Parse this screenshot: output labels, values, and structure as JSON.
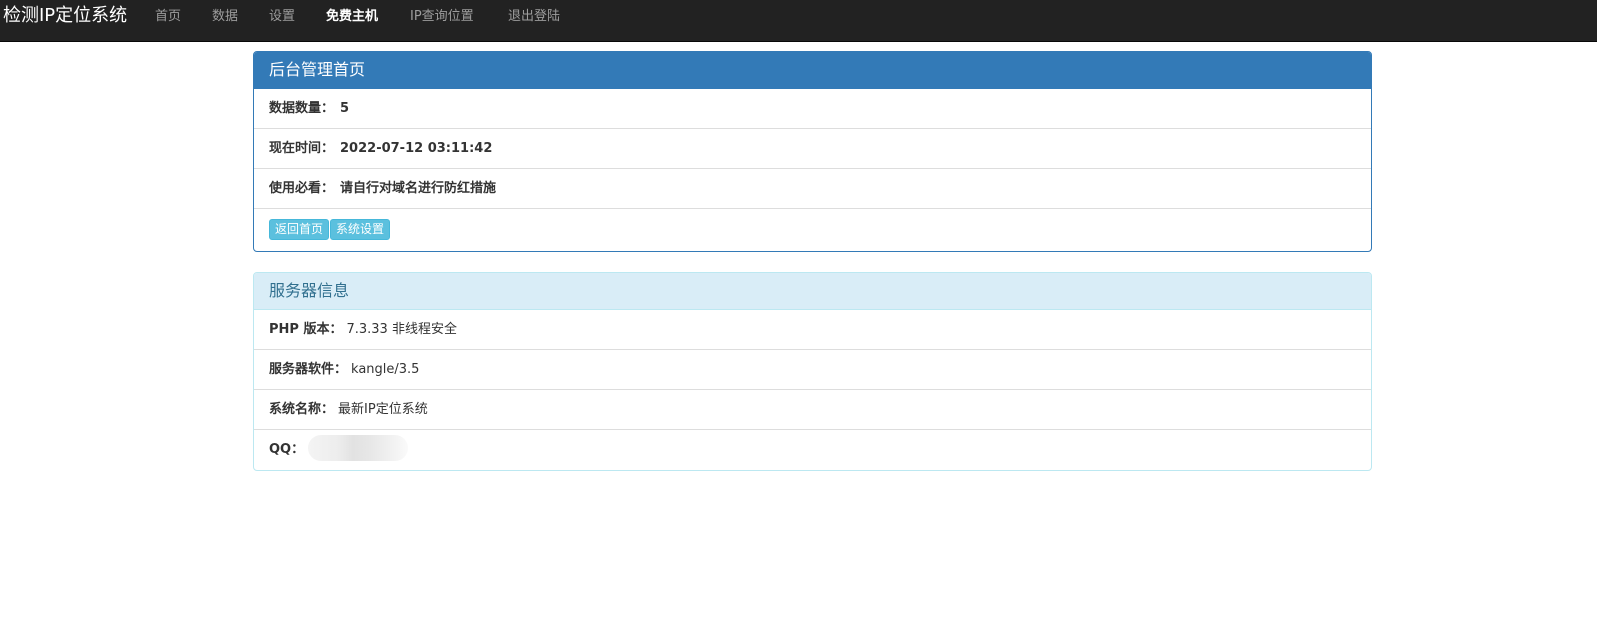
{
  "navbar": {
    "brand": "检测IP定位系统",
    "items": [
      {
        "label": "首页"
      },
      {
        "label": "数据"
      },
      {
        "label": "设置"
      },
      {
        "label": "免费主机"
      },
      {
        "label": "IP查询位置"
      },
      {
        "label": "退出登陆"
      }
    ],
    "active_item": "免费主机"
  },
  "admin_panel": {
    "title": "后台管理首页",
    "rows": [
      {
        "label": "数据数量：",
        "value": "5"
      },
      {
        "label": "现在时间：",
        "value": "2022-07-12 03:11:42"
      },
      {
        "label": "使用必看：",
        "value": "请自行对域名进行防红措施"
      }
    ],
    "buttons": {
      "home": "返回首页",
      "settings": "系统设置"
    }
  },
  "server_panel": {
    "title": "服务器信息",
    "rows": [
      {
        "label": "PHP 版本：",
        "value": "7.3.33 非线程安全"
      },
      {
        "label": "服务器软件：",
        "value": "kangle/3.5"
      },
      {
        "label": "系统名称：",
        "value": "最新IP定位系统"
      },
      {
        "label": "QQ：",
        "value": ""
      }
    ]
  },
  "colors": {
    "navbar_bg": "#222222",
    "primary": "#337ab7",
    "info_bg": "#d9edf7",
    "info_text": "#31708f",
    "button": "#5bc0de"
  }
}
